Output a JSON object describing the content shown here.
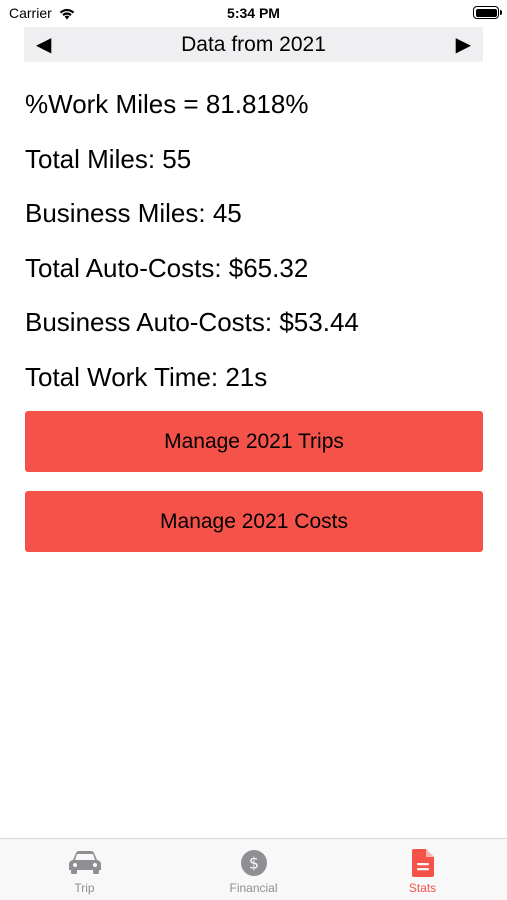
{
  "status_bar": {
    "carrier": "Carrier",
    "time": "5:34 PM"
  },
  "year_nav": {
    "prev_arrow": "◀",
    "title": "Data from 2021",
    "next_arrow": "▶"
  },
  "stats": {
    "work_miles_pct": "%Work Miles = 81.818%",
    "total_miles": "Total Miles: 55",
    "business_miles": "Business Miles: 45",
    "total_auto_costs": "Total Auto-Costs: $65.32",
    "business_auto_costs": "Business Auto-Costs: $53.44",
    "total_work_time": "Total Work Time: 21s"
  },
  "buttons": {
    "manage_trips": "Manage 2021 Trips",
    "manage_costs": "Manage 2021 Costs"
  },
  "tab_bar": {
    "tabs": [
      {
        "label": "Trip",
        "icon": "car-icon",
        "active": false
      },
      {
        "label": "Financial",
        "icon": "dollar-icon",
        "active": false
      },
      {
        "label": "Stats",
        "icon": "document-icon",
        "active": true
      }
    ]
  },
  "colors": {
    "accent": "#f5534a",
    "nav_background": "#efeff2",
    "inactive_tab": "#8e8e93"
  }
}
